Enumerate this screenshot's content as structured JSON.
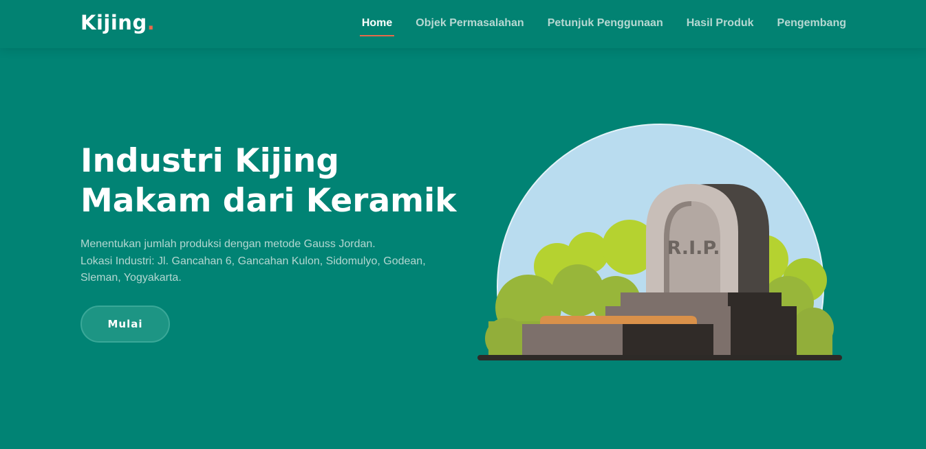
{
  "header": {
    "logo_text": "Kijing",
    "logo_dot": ".",
    "nav": [
      {
        "label": "Home",
        "active": true
      },
      {
        "label": "Objek Permasalahan",
        "active": false
      },
      {
        "label": "Petunjuk Penggunaan",
        "active": false
      },
      {
        "label": "Hasil Produk",
        "active": false
      },
      {
        "label": "Pengembang",
        "active": false
      }
    ]
  },
  "hero": {
    "title_line1": "Industri Kijing",
    "title_line2": "Makam dari Keramik",
    "desc_line1": "Menentukan jumlah produksi dengan metode Gauss Jordan.",
    "desc_line2": "Lokasi Industri: Jl. Gancahan 6, Gancahan Kulon, Sidomulyo, Godean,",
    "desc_line3": "Sleman, Yogyakarta.",
    "cta_label": "Mulai"
  },
  "illustration": {
    "tombstone_text": "R.I.P."
  },
  "colors": {
    "background": "#018374",
    "accent": "#e9694a",
    "nav_inactive": "#b6d8d2",
    "sky": "#b9dcef"
  }
}
